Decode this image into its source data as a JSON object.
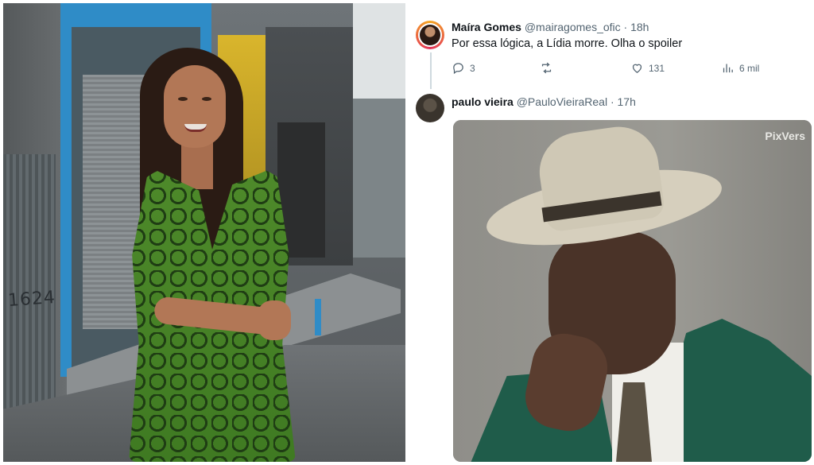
{
  "graffiti_text": "1624",
  "tweets": [
    {
      "display_name": "Maíra Gomes",
      "handle": "@mairagomes_ofic",
      "separator": "·",
      "time": "18h",
      "text": "Por essa lógica, a Lídia morre. Olha o spoiler",
      "actions": {
        "replies": "3",
        "retweets": "",
        "likes": "131",
        "views": "6 mil"
      }
    },
    {
      "display_name": "paulo vieira",
      "handle": "@PauloVieiraReal",
      "separator": "·",
      "time": "17h",
      "media": {
        "watermark": "PixVers"
      }
    }
  ],
  "colors": {
    "text_primary": "#0f1419",
    "text_secondary": "#536471",
    "thread_line": "#cfd9de",
    "dress_green": "#4e8a2a",
    "door_blue": "#2f8cc7"
  },
  "icons": [
    "reply-icon",
    "retweet-icon",
    "like-icon",
    "views-icon"
  ]
}
